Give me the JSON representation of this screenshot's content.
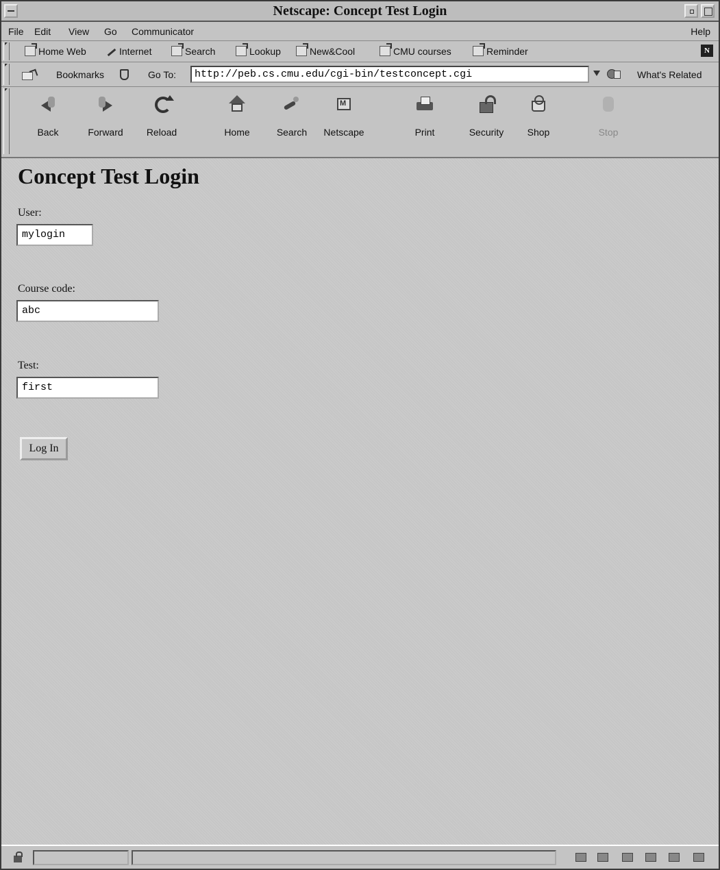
{
  "window": {
    "title": "Netscape: Concept Test Login"
  },
  "menubar": {
    "items": [
      "File",
      "Edit",
      "View",
      "Go",
      "Communicator"
    ],
    "help": "Help"
  },
  "personal_toolbar": {
    "items": [
      "Home Web",
      "Internet",
      "Search",
      "Lookup",
      "New&Cool",
      "CMU courses",
      "Reminder"
    ]
  },
  "location": {
    "bookmarks_label": "Bookmarks",
    "goto_label": "Go To:",
    "url": "http://peb.cs.cmu.edu/cgi-bin/testconcept.cgi",
    "related_label": "What's Related"
  },
  "navigation": {
    "back": "Back",
    "forward": "Forward",
    "reload": "Reload",
    "home": "Home",
    "search": "Search",
    "netscape": "Netscape",
    "print": "Print",
    "security": "Security",
    "shop": "Shop",
    "stop": "Stop"
  },
  "page": {
    "title": "Concept Test Login",
    "user_label": "User:",
    "user_value": "mylogin",
    "course_label": "Course code:",
    "course_value": "abc",
    "test_label": "Test:",
    "test_value": "first",
    "login_button": "Log In"
  },
  "statusbar": {
    "message": ""
  },
  "colors": {
    "chrome": "#c4c4c4",
    "content_bg": "#c6c6c6",
    "input_bg": "#ffffff"
  }
}
